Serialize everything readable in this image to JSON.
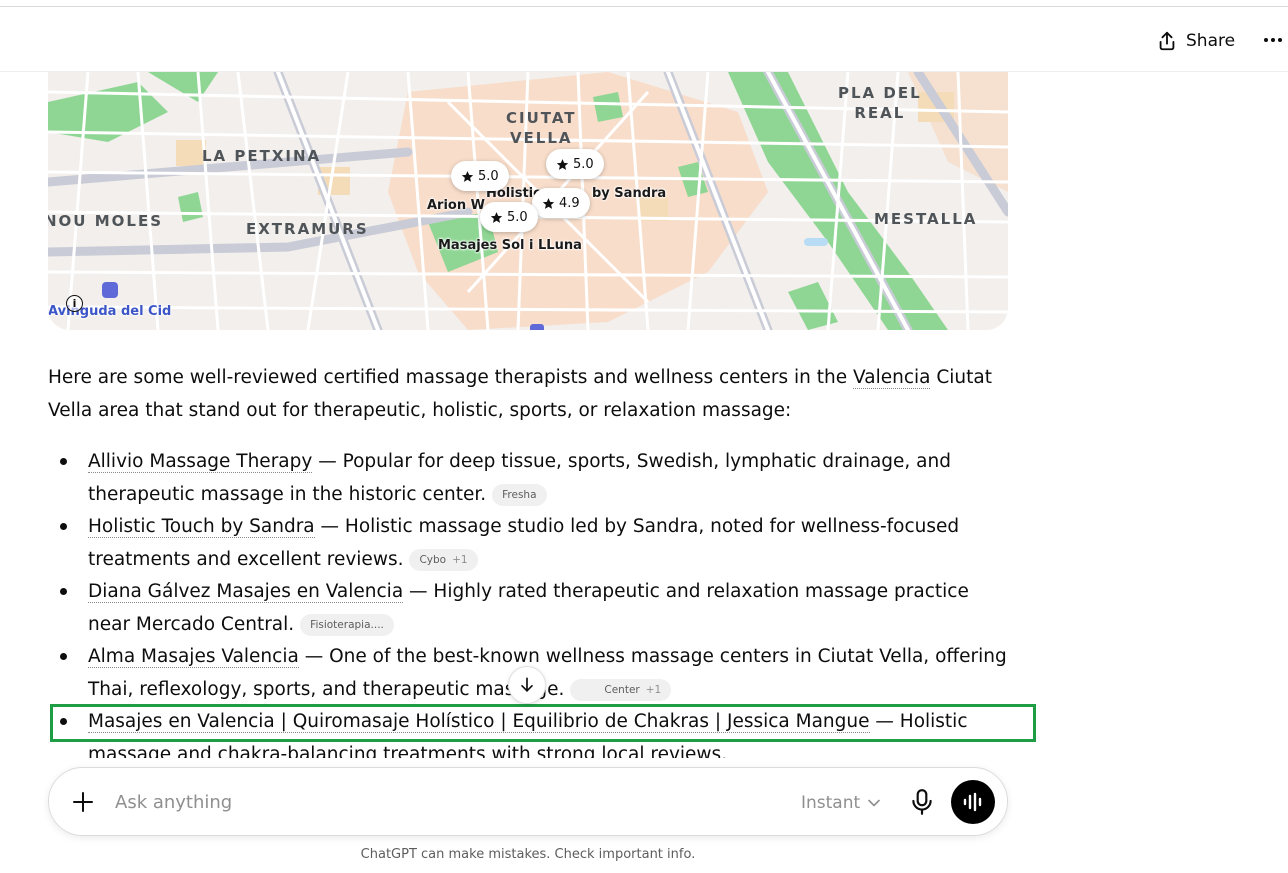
{
  "header": {
    "share_label": "Share"
  },
  "map": {
    "districts": [
      {
        "name": "CIUTAT\nVELLA"
      },
      {
        "name": "PLA DEL\nREAL"
      },
      {
        "name": "LA PETXINA"
      },
      {
        "name": "NOU MOLES"
      },
      {
        "name": "EXTRAMURS"
      },
      {
        "name": "MESTALLA"
      }
    ],
    "places": [
      {
        "name": "Holistic"
      },
      {
        "name": "by Sandra"
      },
      {
        "name": "Arion W"
      },
      {
        "name": "Masajes Sol i LLuna"
      },
      {
        "name": "Avinguda del Cid"
      }
    ],
    "pins": [
      {
        "rating": "5.0"
      },
      {
        "rating": "5.0"
      },
      {
        "rating": "4.9"
      },
      {
        "rating": "5.0"
      }
    ],
    "info_glyph": "i"
  },
  "intro": {
    "before": "Here are some well-reviewed certified massage therapists and wellness centers in the ",
    "link": "Valencia",
    "after": " Ciutat Vella area that stand out for therapeutic, holistic, sports, or relaxation massage:"
  },
  "items": [
    {
      "name": "Allivio Massage Therapy",
      "desc": " — Popular for deep tissue, sports, Swedish, lymphatic drainage, and therapeutic massage in the historic center.",
      "source": "Fresha",
      "extra": ""
    },
    {
      "name": "Holistic Touch by Sandra",
      "desc": " — Holistic massage studio led by Sandra, noted for wellness-focused treatments and excellent reviews.",
      "source": "Cybo",
      "extra": "+1"
    },
    {
      "name": "Diana Gálvez Masajes en Valencia",
      "desc": " — Highly rated therapeutic and relaxation massage practice near Mercado Central.",
      "source": "Fisioterapia....",
      "extra": ""
    },
    {
      "name": "Alma Masajes Valencia",
      "desc": " — One of the best-known wellness massage centers in Ciutat Vella, offering Thai, reflexology, sports, and therapeutic massage.",
      "source": "Center",
      "extra": "+1"
    },
    {
      "name": "Masajes en Valencia | Quiromasaje Holístico | Equilibrio de Chakras | Jessica Mangue",
      "desc": " — Holistic massage and chakra-balancing treatments with strong local reviews.",
      "source": "",
      "extra": ""
    }
  ],
  "composer": {
    "placeholder": "Ask anything",
    "model": "Instant"
  },
  "footer": {
    "disclaimer": "ChatGPT can make mistakes. Check important info."
  },
  "colors": {
    "highlight": "#1f9d45",
    "map_bg": "#f2efec",
    "park": "#8fd694",
    "old_town": "#f9d7bf"
  }
}
